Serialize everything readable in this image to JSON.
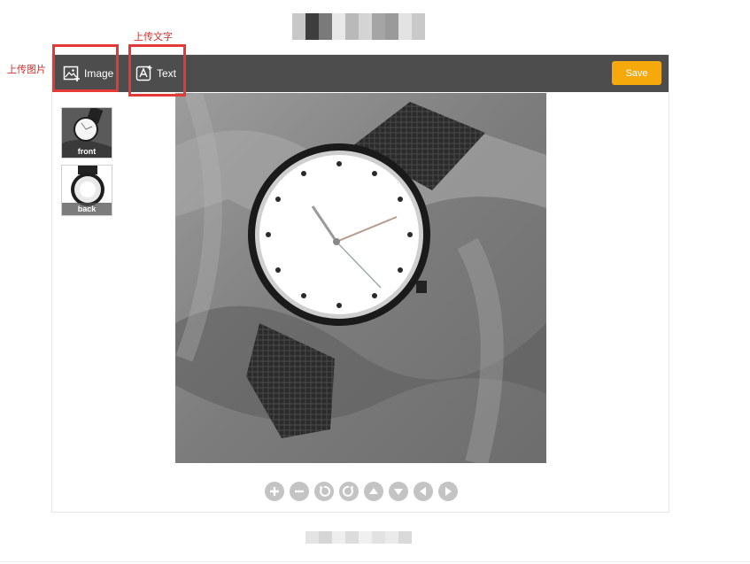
{
  "annotations": {
    "image_label": "上传图片",
    "text_label": "上传文字"
  },
  "toolbar": {
    "image_label": "Image",
    "text_label": "Text",
    "save_label": "Save"
  },
  "thumbnails": [
    {
      "label": "front"
    },
    {
      "label": "back"
    }
  ],
  "controls": [
    "zoom-in-icon",
    "zoom-out-icon",
    "rotate-left-icon",
    "rotate-right-icon",
    "move-up-icon",
    "move-down-icon",
    "move-left-icon",
    "move-right-icon"
  ],
  "colors": {
    "toolbar": "#4d4d4d",
    "save": "#f5a90b",
    "annotation": "#e53935"
  }
}
